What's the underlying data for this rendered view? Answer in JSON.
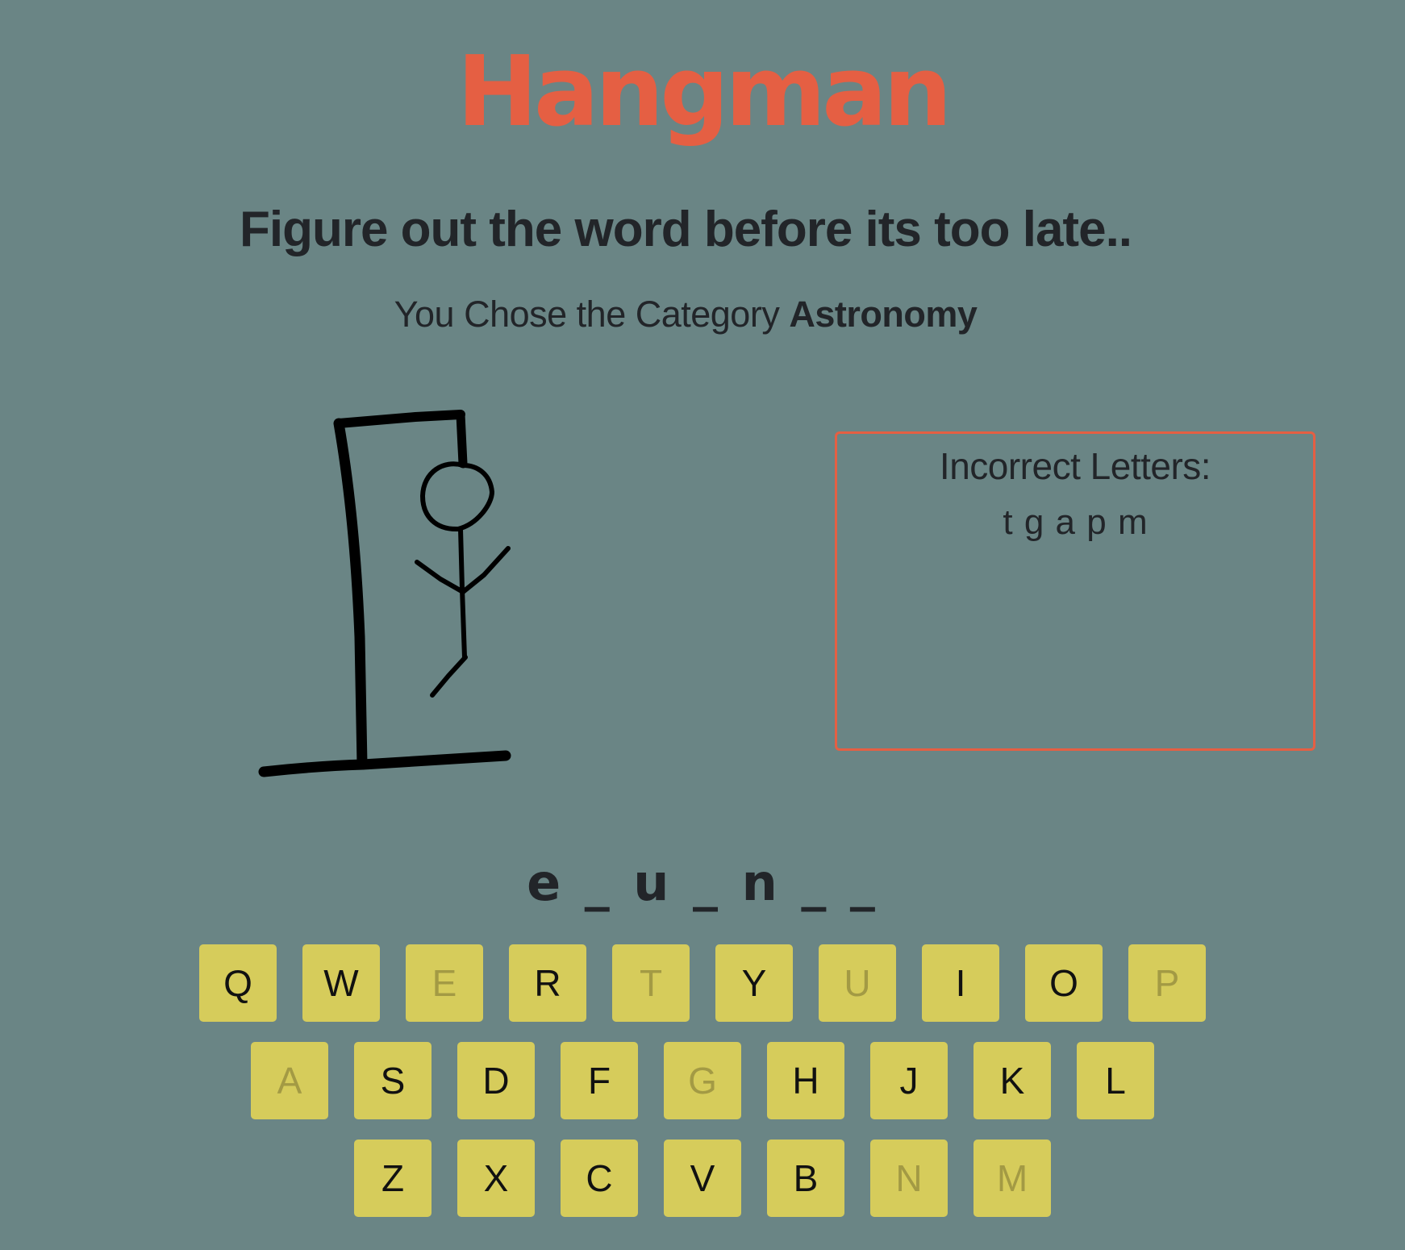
{
  "title": "Hangman",
  "subtitle": "Figure out the word before its too late..",
  "category": {
    "prefix": "You Chose the Category",
    "name": "Astronomy"
  },
  "wrong": {
    "title": "Incorrect Letters:",
    "letters": "t g a p m"
  },
  "word_display": "e _ u _ n _ _",
  "keyboard": {
    "rows": [
      [
        {
          "label": "Q",
          "used": false
        },
        {
          "label": "W",
          "used": false
        },
        {
          "label": "E",
          "used": true
        },
        {
          "label": "R",
          "used": false
        },
        {
          "label": "T",
          "used": true
        },
        {
          "label": "Y",
          "used": false
        },
        {
          "label": "U",
          "used": true
        },
        {
          "label": "I",
          "used": false
        },
        {
          "label": "O",
          "used": false
        },
        {
          "label": "P",
          "used": true
        }
      ],
      [
        {
          "label": "A",
          "used": true
        },
        {
          "label": "S",
          "used": false
        },
        {
          "label": "D",
          "used": false
        },
        {
          "label": "F",
          "used": false
        },
        {
          "label": "G",
          "used": true
        },
        {
          "label": "H",
          "used": false
        },
        {
          "label": "J",
          "used": false
        },
        {
          "label": "K",
          "used": false
        },
        {
          "label": "L",
          "used": false
        }
      ],
      [
        {
          "label": "Z",
          "used": false
        },
        {
          "label": "X",
          "used": false
        },
        {
          "label": "C",
          "used": false
        },
        {
          "label": "V",
          "used": false
        },
        {
          "label": "B",
          "used": false
        },
        {
          "label": "N",
          "used": true
        },
        {
          "label": "M",
          "used": true
        }
      ]
    ]
  },
  "colors": {
    "background": "#6a8585",
    "accent": "#e55f43",
    "key": "#d6cc5b",
    "key_used_text": "#a39a44",
    "text": "#222529"
  },
  "hangman": {
    "parts_shown": [
      "head",
      "body",
      "left-arm",
      "right-arm",
      "left-leg"
    ],
    "wrong_count": 5
  }
}
